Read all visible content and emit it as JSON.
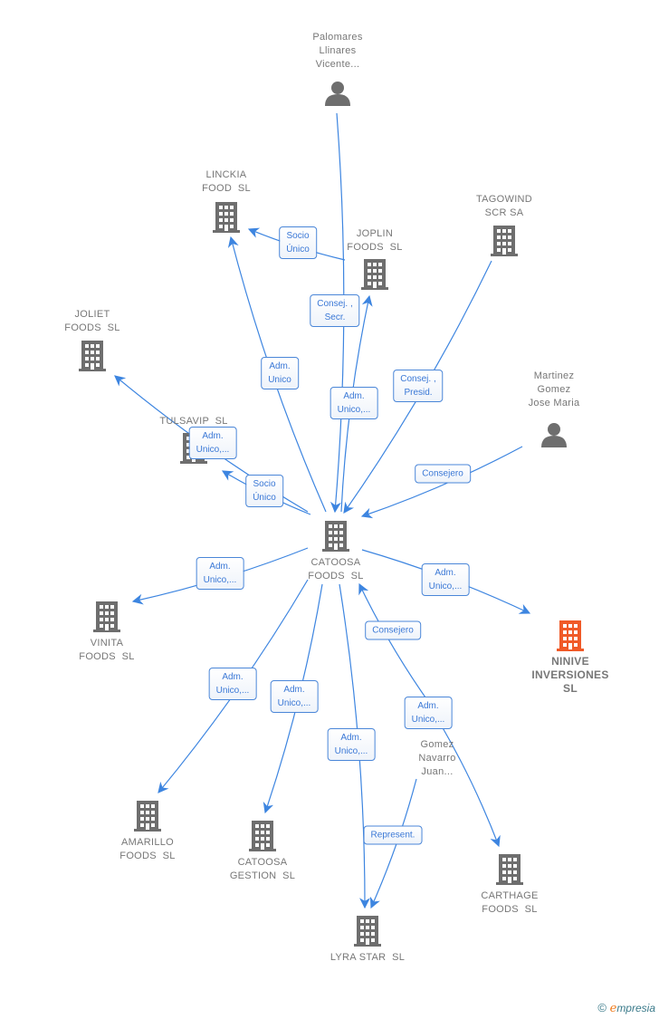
{
  "colors": {
    "edge": "#3d85e0",
    "node": "#6e6e6e",
    "highlight": "#f05a28"
  },
  "nodes": [
    {
      "id": "palomares",
      "type": "person",
      "label": "Palomares\nLlinares\nVicente..."
    },
    {
      "id": "linckia",
      "type": "company",
      "label": "LINCKIA\nFOOD  SL"
    },
    {
      "id": "joplin",
      "type": "company",
      "label": "JOPLIN\nFOODS  SL"
    },
    {
      "id": "tagowind",
      "type": "company",
      "label": "TAGOWIND\nSCR SA"
    },
    {
      "id": "joliet",
      "type": "company",
      "label": "JOLIET\nFOODS  SL"
    },
    {
      "id": "tulsavip",
      "type": "company",
      "label": "TULSAVIP  SL"
    },
    {
      "id": "martinez",
      "type": "person",
      "label": "Martinez\nGomez\nJose Maria"
    },
    {
      "id": "catoosa",
      "type": "company",
      "label": "CATOOSA\nFOODS  SL"
    },
    {
      "id": "vinita",
      "type": "company",
      "label": "VINITA\nFOODS  SL"
    },
    {
      "id": "ninive",
      "type": "company",
      "highlight": true,
      "label": "NINIVE\nINVERSIONES\nSL"
    },
    {
      "id": "gomez",
      "type": "person",
      "label": "Gomez\nNavarro\nJuan..."
    },
    {
      "id": "amarillo",
      "type": "company",
      "label": "AMARILLO\nFOODS  SL"
    },
    {
      "id": "catoosagestion",
      "type": "company",
      "label": "CATOOSA\nGESTION  SL"
    },
    {
      "id": "carthage",
      "type": "company",
      "label": "CARTHAGE\nFOODS  SL"
    },
    {
      "id": "lyra",
      "type": "company",
      "label": "LYRA STAR  SL"
    }
  ],
  "edges": [
    {
      "from": "palomares",
      "to": "catoosa",
      "label": "Consej. ,\nSecr."
    },
    {
      "from": "joplin",
      "to": "linckia",
      "label": "Socio\nÚnico"
    },
    {
      "from": "catoosa",
      "to": "linckia",
      "label": "Adm.\nUnico"
    },
    {
      "from": "catoosa",
      "to": "joplin",
      "label": "Adm.\nUnico,..."
    },
    {
      "from": "tagowind",
      "to": "catoosa",
      "label": "Consej. ,\nPresid."
    },
    {
      "from": "martinez",
      "to": "catoosa",
      "label": "Consejero"
    },
    {
      "from": "catoosa",
      "to": "joliet",
      "label": "Adm.\nUnico,..."
    },
    {
      "from": "catoosa",
      "to": "tulsavip",
      "label": "Socio\nÚnico"
    },
    {
      "from": "catoosa",
      "to": "vinita",
      "label": "Adm.\nUnico,..."
    },
    {
      "from": "catoosa",
      "to": "ninive",
      "label": "Adm.\nUnico,..."
    },
    {
      "from": "gomez",
      "to": "catoosa",
      "label": "Consejero"
    },
    {
      "from": "catoosa",
      "to": "amarillo",
      "label": "Adm.\nUnico,..."
    },
    {
      "from": "catoosa",
      "to": "catoosagestion",
      "label": "Adm.\nUnico,..."
    },
    {
      "from": "catoosa",
      "to": "lyra",
      "label": "Adm.\nUnico,..."
    },
    {
      "from": "gomez",
      "to": "carthage",
      "label": "Adm.\nUnico,..."
    },
    {
      "from": "gomez",
      "to": "lyra",
      "label": "Represent."
    }
  ],
  "footer": {
    "copyright": "©",
    "brand_initial": "e",
    "brand_rest": "mpresia"
  }
}
